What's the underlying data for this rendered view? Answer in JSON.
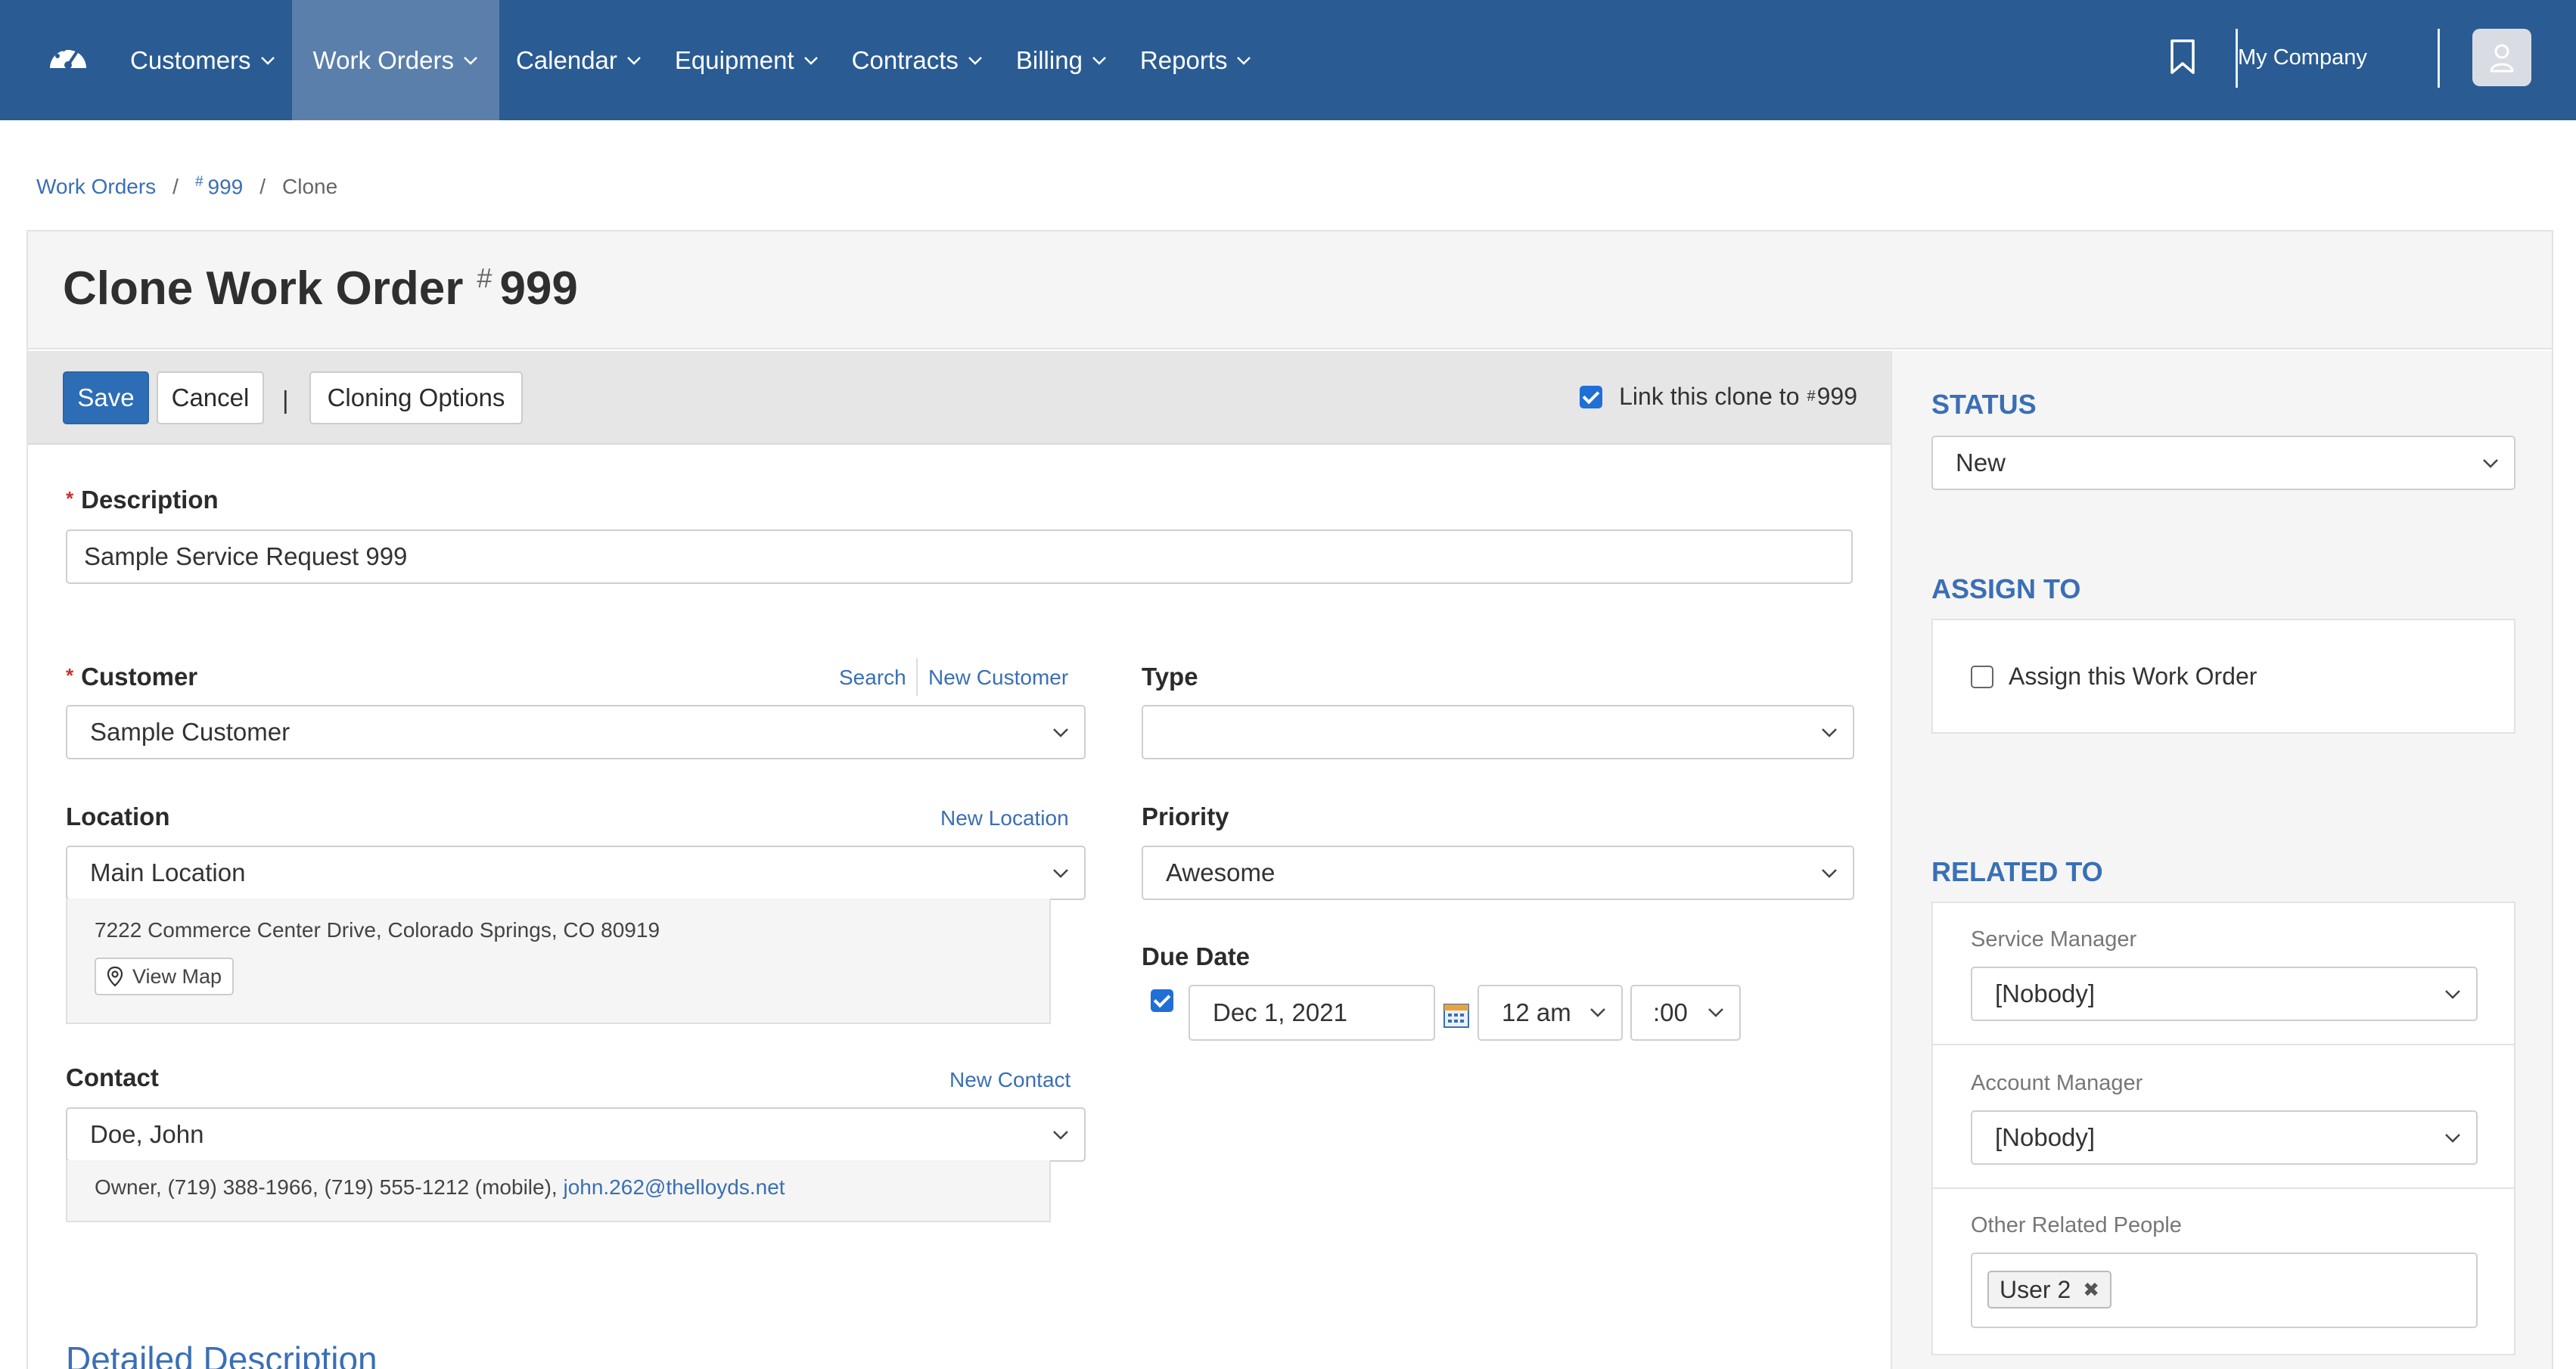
{
  "nav": {
    "brand_icon": "dashboard-gauge-icon",
    "items": [
      {
        "label": "Customers"
      },
      {
        "label": "Work Orders",
        "active": true
      },
      {
        "label": "Calendar"
      },
      {
        "label": "Equipment"
      },
      {
        "label": "Contracts"
      },
      {
        "label": "Billing"
      },
      {
        "label": "Reports"
      }
    ],
    "company": "My Company",
    "bookmark_icon": "bookmark-icon",
    "avatar_icon": "user-icon"
  },
  "breadcrumb": {
    "root": "Work Orders",
    "hash": "#",
    "number": "999",
    "current": "Clone"
  },
  "page": {
    "title": "Clone Work Order",
    "hash": "#",
    "number": "999"
  },
  "toolbar": {
    "save": "Save",
    "cancel": "Cancel",
    "pipe": "|",
    "cloning_options": "Cloning Options",
    "link_label": "Link this clone to",
    "link_hash": "#",
    "link_number": "999",
    "link_checked": true
  },
  "form": {
    "description": {
      "label": "Description",
      "value": "Sample Service Request 999"
    },
    "customer": {
      "label": "Customer",
      "value": "Sample Customer",
      "search": "Search",
      "new": "New Customer"
    },
    "location": {
      "label": "Location",
      "value": "Main Location",
      "new": "New Location",
      "address": "7222 Commerce Center Drive, Colorado Springs, CO 80919",
      "view_map": "View Map"
    },
    "contact": {
      "label": "Contact",
      "value": "Doe, John",
      "new": "New Contact",
      "details": "Owner, (719) 388-1966, (719) 555-1212 (mobile),",
      "email": "john.262@thelloyds.net"
    },
    "type": {
      "label": "Type",
      "value": ""
    },
    "priority": {
      "label": "Priority",
      "value": "Awesome"
    },
    "due_date": {
      "label": "Due Date",
      "checked": true,
      "date": "Dec 1, 2021",
      "hour": "12 am",
      "minute": ":00"
    },
    "detailed_description_title": "Detailed Description"
  },
  "sidebar": {
    "status": {
      "title": "STATUS",
      "value": "New"
    },
    "assign": {
      "title": "ASSIGN TO",
      "checkbox_label": "Assign this Work Order",
      "checked": false
    },
    "related": {
      "title": "RELATED TO",
      "service_manager": {
        "label": "Service Manager",
        "value": "[Nobody]"
      },
      "account_manager": {
        "label": "Account Manager",
        "value": "[Nobody]"
      },
      "other": {
        "label": "Other Related People",
        "tags": [
          "User 2"
        ]
      }
    }
  },
  "colors": {
    "nav_bg": "#2a5b93",
    "nav_active": "#5b7fab",
    "accent": "#3a6fb5",
    "primary_button": "#2d6db5",
    "required": "#c9302c"
  }
}
